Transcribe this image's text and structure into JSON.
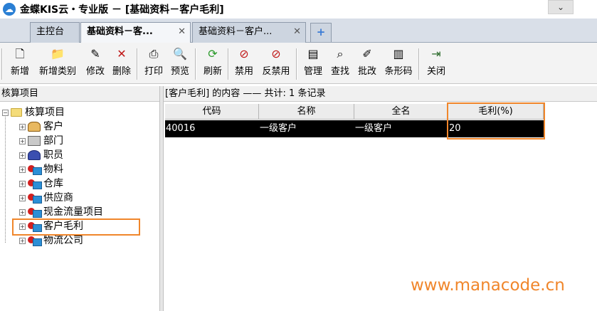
{
  "window": {
    "title": "金蝶KIS云・专业版 － [基础资料－客户毛利]",
    "collapse_icon": "chevron-down-icon"
  },
  "tabs": [
    {
      "label": "主控台",
      "closable": false,
      "active": false
    },
    {
      "label": "基础资料－客...",
      "closable": true,
      "active": true
    },
    {
      "label": "基础资料－客户...",
      "closable": true,
      "active": false
    }
  ],
  "tab_add_label": "+",
  "toolbar": {
    "items": [
      {
        "label": "新增",
        "icon": "new-doc-icon",
        "glyph": "🗋"
      },
      {
        "label": "新增类别",
        "icon": "new-folder-icon",
        "glyph": "📁"
      },
      {
        "label": "修改",
        "icon": "edit-icon",
        "glyph": "✎"
      },
      {
        "label": "删除",
        "icon": "delete-icon",
        "glyph": "✕"
      },
      {
        "label": "打印",
        "icon": "print-icon",
        "glyph": "⎙"
      },
      {
        "label": "预览",
        "icon": "preview-icon",
        "glyph": "🔍"
      },
      {
        "label": "刷新",
        "icon": "refresh-icon",
        "glyph": "⟳"
      },
      {
        "label": "禁用",
        "icon": "disable-icon",
        "glyph": "⊘"
      },
      {
        "label": "反禁用",
        "icon": "enable-icon",
        "glyph": "⊘"
      },
      {
        "label": "管理",
        "icon": "manage-icon",
        "glyph": "▤"
      },
      {
        "label": "查找",
        "icon": "find-icon",
        "glyph": "⌕"
      },
      {
        "label": "批改",
        "icon": "batch-edit-icon",
        "glyph": "✐"
      },
      {
        "label": "条形码",
        "icon": "barcode-icon",
        "glyph": "▥"
      },
      {
        "label": "关闭",
        "icon": "close-door-icon",
        "glyph": "⇥"
      }
    ]
  },
  "left_panel": {
    "header": "核算项目",
    "root": {
      "label": "核算项目",
      "expander": "−"
    },
    "children": [
      {
        "label": "客户",
        "icon": "customer-icon",
        "expander": "+"
      },
      {
        "label": "部门",
        "icon": "department-icon",
        "expander": "+"
      },
      {
        "label": "职员",
        "icon": "employee-icon",
        "expander": "+"
      },
      {
        "label": "物料",
        "icon": "item-class-icon",
        "expander": "+"
      },
      {
        "label": "仓库",
        "icon": "item-class-icon",
        "expander": "+"
      },
      {
        "label": "供应商",
        "icon": "item-class-icon",
        "expander": "+"
      },
      {
        "label": "现金流量项目",
        "icon": "item-class-icon",
        "expander": "+"
      },
      {
        "label": "客户毛利",
        "icon": "item-class-icon",
        "expander": "+",
        "highlighted": true
      },
      {
        "label": "物流公司",
        "icon": "item-class-icon",
        "expander": "+"
      }
    ]
  },
  "right_panel": {
    "header": "[客户毛利] 的内容 —— 共计: 1 条记录",
    "columns": [
      "代码",
      "名称",
      "全名",
      "毛利(%)"
    ],
    "rows": [
      [
        "40016",
        "一级客户",
        "一级客户",
        "20"
      ]
    ]
  },
  "watermark": "www.manacode.cn",
  "colors": {
    "highlight_box": "#f0862b",
    "selected_row_bg": "#000000",
    "selected_row_text": "#ffffff"
  }
}
